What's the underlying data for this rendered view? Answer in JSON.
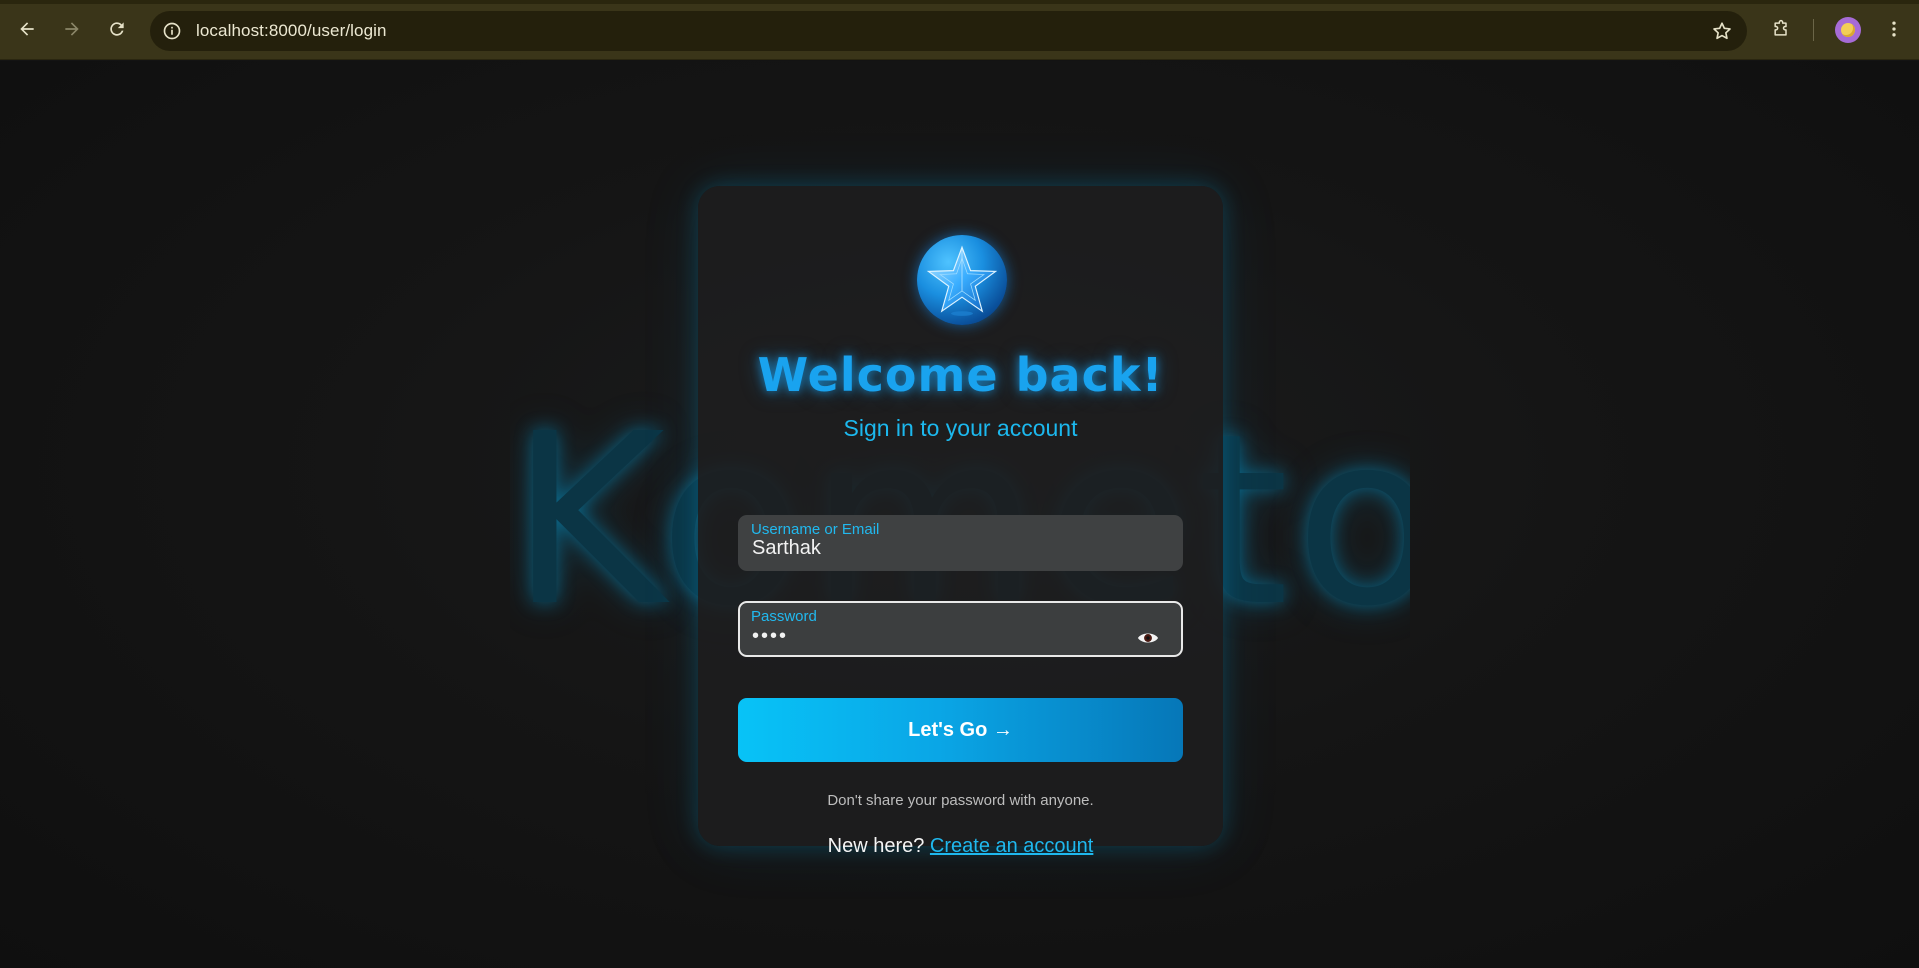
{
  "browser": {
    "url": "localhost:8000/user/login",
    "icons": {
      "back": "back-arrow-icon",
      "forward": "forward-arrow-icon",
      "reload": "reload-icon",
      "site_info": "info-icon",
      "bookmark": "star-icon",
      "extensions": "puzzle-icon",
      "menu": "kebab-menu-icon"
    }
  },
  "background": {
    "brand_word": "Kometon"
  },
  "login": {
    "title": "Welcome back!",
    "subtitle": "Sign in to your account",
    "username": {
      "label": "Username or Email",
      "value": "Sarthak"
    },
    "password": {
      "label": "Password",
      "value": "••••"
    },
    "submit_label": "Let's Go →",
    "hint": "Don't share your password with anyone.",
    "signup_prompt": "New here?",
    "signup_link": "Create an account"
  },
  "colors": {
    "accent": "#1cb8ee",
    "title": "#19a3ef",
    "button_start": "#08c3f7",
    "button_end": "#0677b8",
    "chrome_bg": "#3a3519"
  }
}
